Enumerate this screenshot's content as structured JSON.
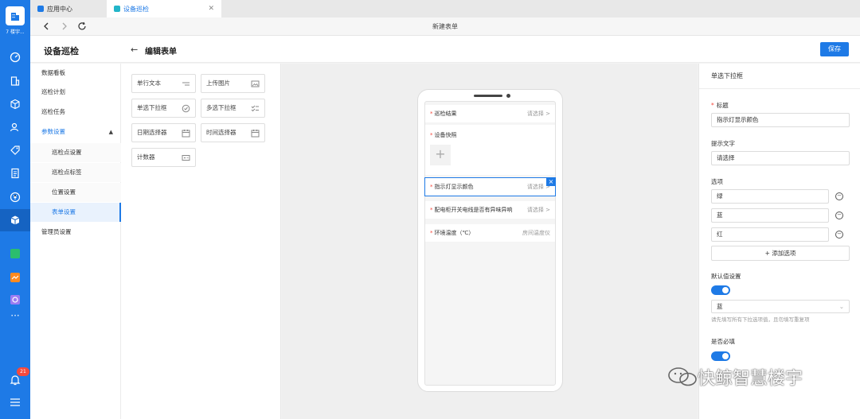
{
  "rail": {
    "org_name": "7 楼宇...",
    "notification_count": "21"
  },
  "tabs": [
    {
      "label": "应用中心"
    },
    {
      "label": "设备巡检"
    }
  ],
  "addressbar": {
    "title": "新建表单"
  },
  "header": {
    "module_title": "设备巡检",
    "page_title": "编辑表单",
    "save_label": "保存"
  },
  "sidebar": {
    "items": [
      "数据看板",
      "巡检计划",
      "巡检任务",
      "参数设置",
      "巡检点设置",
      "巡检点标签",
      "位置设置",
      "表单设置",
      "管理员设置"
    ]
  },
  "palette": {
    "components": [
      "单行文本",
      "上传图片",
      "单选下拉框",
      "多选下拉框",
      "日期选择器",
      "时间选择器",
      "计数器"
    ]
  },
  "form": {
    "fields": [
      {
        "label": "巡检结果",
        "placeholder": "请选择 >"
      },
      {
        "label": "设备快照"
      },
      {
        "label": "指示灯显示颜色",
        "placeholder": "请选择 >"
      },
      {
        "label": "配电柜开关电线是否有异味异响",
        "placeholder": "请选择 >"
      },
      {
        "label": "环境温度（℃）",
        "placeholder": "房间温度仪"
      }
    ],
    "add_symbol": "+",
    "delete_symbol": "×"
  },
  "props": {
    "title": "单选下拉框",
    "label_title": "标题",
    "title_value": "指示灯显示颜色",
    "label_hint": "提示文字",
    "hint_value": "请选择",
    "label_options": "选项",
    "options": [
      "绿",
      "蓝",
      "红"
    ],
    "add_option": "+ 添加选项",
    "label_default": "默认值设置",
    "default_on": true,
    "default_value": "蓝",
    "default_help": "请先填写所有下拉选项值，且勿填写重复项",
    "label_required": "是否必填",
    "required_on": true
  },
  "watermark": {
    "text": "快鲸智慧楼宇"
  },
  "colors": {
    "accent": "#1e7ae6",
    "required": "#f5493d",
    "badge": "#f5493d"
  }
}
